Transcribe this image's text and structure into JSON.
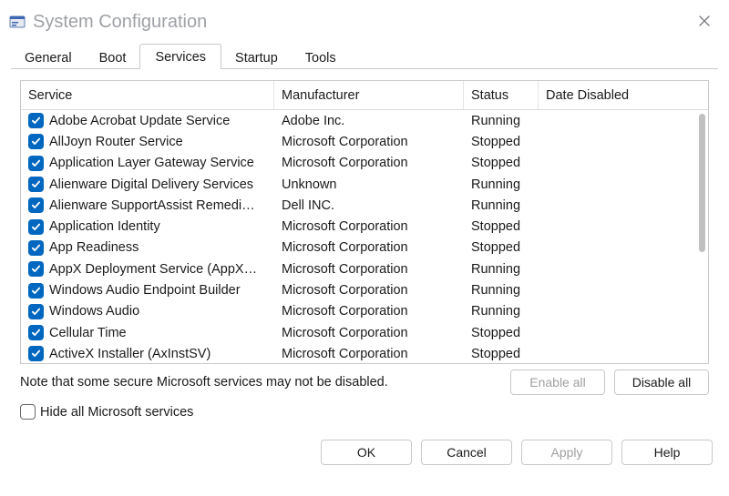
{
  "window": {
    "title": "System Configuration"
  },
  "tabs": [
    "General",
    "Boot",
    "Services",
    "Startup",
    "Tools"
  ],
  "activeTab": "Services",
  "columns": {
    "service": "Service",
    "manufacturer": "Manufacturer",
    "status": "Status",
    "dateDisabled": "Date Disabled"
  },
  "services": [
    {
      "name": "Adobe Acrobat Update Service",
      "manufacturer": "Adobe Inc.",
      "status": "Running",
      "checked": true
    },
    {
      "name": "AllJoyn Router Service",
      "manufacturer": "Microsoft Corporation",
      "status": "Stopped",
      "checked": true
    },
    {
      "name": "Application Layer Gateway Service",
      "manufacturer": "Microsoft Corporation",
      "status": "Stopped",
      "checked": true
    },
    {
      "name": "Alienware Digital Delivery Services",
      "manufacturer": "Unknown",
      "status": "Running",
      "checked": true
    },
    {
      "name": "Alienware SupportAssist Remedi…",
      "manufacturer": "Dell INC.",
      "status": "Running",
      "checked": true
    },
    {
      "name": "Application Identity",
      "manufacturer": "Microsoft Corporation",
      "status": "Stopped",
      "checked": true
    },
    {
      "name": "App Readiness",
      "manufacturer": "Microsoft Corporation",
      "status": "Stopped",
      "checked": true
    },
    {
      "name": "AppX Deployment Service (AppX…",
      "manufacturer": "Microsoft Corporation",
      "status": "Running",
      "checked": true
    },
    {
      "name": "Windows Audio Endpoint Builder",
      "manufacturer": "Microsoft Corporation",
      "status": "Running",
      "checked": true
    },
    {
      "name": "Windows Audio",
      "manufacturer": "Microsoft Corporation",
      "status": "Running",
      "checked": true
    },
    {
      "name": "Cellular Time",
      "manufacturer": "Microsoft Corporation",
      "status": "Stopped",
      "checked": true
    },
    {
      "name": "ActiveX Installer (AxInstSV)",
      "manufacturer": "Microsoft Corporation",
      "status": "Stopped",
      "checked": true
    }
  ],
  "noteText": "Note that some secure Microsoft services may not be disabled.",
  "hideCheckbox": {
    "label": "Hide all Microsoft services",
    "checked": false
  },
  "buttons": {
    "enableAll": "Enable all",
    "disableAll": "Disable all",
    "ok": "OK",
    "cancel": "Cancel",
    "apply": "Apply",
    "help": "Help"
  }
}
